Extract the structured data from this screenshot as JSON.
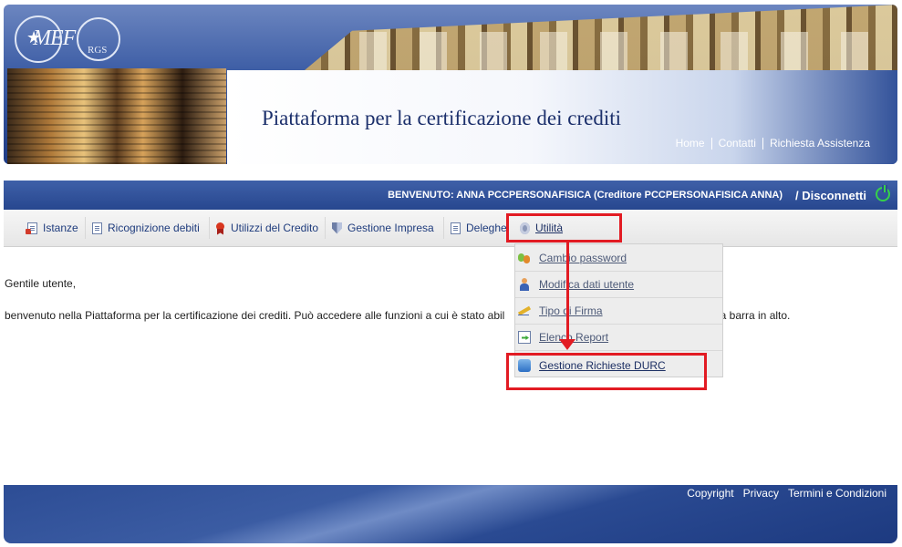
{
  "header": {
    "logo_text": "MEF",
    "logo_subtext": "RGS",
    "title_accent": "Piattaforma",
    "title_rest": " per la certificazione dei crediti",
    "nav": [
      "Home",
      "Contatti",
      "Richiesta Assistenza"
    ]
  },
  "welcome_bar": {
    "text": "BENVENUTO: ANNA PCCPERSONAFISICA (Creditore PCCPERSONAFISICA ANNA)",
    "disconnect_label": "/ Disconnetti",
    "power_icon": "power-icon",
    "power_color": "#36d14a"
  },
  "menu": {
    "items": [
      {
        "label": "Istanze",
        "icon": "document-icon"
      },
      {
        "label": "Ricognizione debiti",
        "icon": "document-icon"
      },
      {
        "label": "Utilizzi del Credito",
        "icon": "ribbon-icon"
      },
      {
        "label": "Gestione Impresa",
        "icon": "shield-icon"
      },
      {
        "label": "Deleghe",
        "icon": "document-icon"
      },
      {
        "label": "Utilità",
        "icon": "gear-icon"
      }
    ]
  },
  "dropdown": {
    "items": [
      {
        "label": "Cambio password",
        "icon": "password-icon"
      },
      {
        "label": "Modifica dati utente",
        "icon": "user-icon"
      },
      {
        "label": "Tipo di Firma",
        "icon": "pen-icon"
      },
      {
        "label": "Elenco Report",
        "icon": "report-icon"
      },
      {
        "label": "Gestione Richieste DURC",
        "icon": "database-icon"
      }
    ]
  },
  "content": {
    "greeting": "Gentile utente,",
    "message_start": "benvenuto nella Piattaforma per la certificazione dei crediti. Può accedere alle funzioni a cui è stato abil",
    "message_end": "lla barra in alto."
  },
  "footer": {
    "links": [
      "Copyright",
      "Privacy",
      "Termini e Condizioni"
    ]
  },
  "colors": {
    "brand_blue": "#27478f",
    "annotation_red": "#e21b23",
    "link_blue": "#1f3c7d"
  }
}
